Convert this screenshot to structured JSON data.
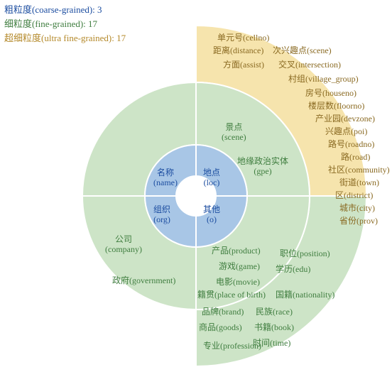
{
  "legend": {
    "coarse": "粗粒度(coarse-grained): 3",
    "fine": "细粒度(fine-grained): 17",
    "ultra": "超细粒度(ultra fine-grained): 17"
  },
  "inner": {
    "name": {
      "zh": "名称",
      "en": "(name)"
    },
    "loc": {
      "zh": "地点",
      "en": "(loc)"
    },
    "org": {
      "zh": "组织",
      "en": "(org)"
    },
    "o": {
      "zh": "其他",
      "en": "(o)"
    }
  },
  "middle": {
    "scene": {
      "zh": "景点",
      "en": "(scene)"
    },
    "gpe": {
      "zh": "地缘政治实体",
      "en": "(gpe)"
    },
    "company": {
      "zh": "公司",
      "en": "(company)"
    },
    "gov": {
      "zh": "政府(government)"
    }
  },
  "outer_top": {
    "cellno": "单元号(cellno)",
    "distance": "距离(distance)",
    "scene2": "次兴趣点(scene)",
    "assist": "方面(assist)",
    "intersection": "交叉(intersection)",
    "village_group": "村组(village_group)",
    "houseno": "房号(houseno)",
    "floorno": "楼层数(floorno)",
    "devzone": "产业园(devzone)",
    "poi": "兴趣点(poi)",
    "roadno": "路号(roadno)",
    "road": "路(road)",
    "community": "社区(community)",
    "town": "街道(town)",
    "district": "区(district)",
    "city": "城市(city)",
    "prov": "省份(prov)"
  },
  "outer_bottom": {
    "product": "产品(product)",
    "position": "职位(position)",
    "game": "游戏(game)",
    "edu": "学历(edu)",
    "movie": "电影(movie)",
    "birthplace": "籍贯(place of birth)",
    "nationality": "国籍(nationality)",
    "brand": "品牌(brand)",
    "race": "民族(race)",
    "goods": "商品(goods)",
    "book": "书籍(book)",
    "time": "时间(time)",
    "profession": "专业(profession)"
  },
  "chart_data": {
    "type": "pie",
    "title": "",
    "rings": [
      {
        "level": "coarse",
        "count": 3,
        "slices": [
          "名称(name)",
          "地点(loc)",
          "组织(org)",
          "其他(o)"
        ]
      },
      {
        "level": "fine",
        "count": 17,
        "slices": [
          "景点(scene)",
          "地缘政治实体(gpe)",
          "公司(company)",
          "政府(government)"
        ]
      },
      {
        "level": "ultra",
        "count": 17,
        "slices": [
          "单元号(cellno)",
          "距离(distance)",
          "次兴趣点(scene)",
          "方面(assist)",
          "交叉(intersection)",
          "村组(village_group)",
          "房号(houseno)",
          "楼层数(floorno)",
          "产业园(devzone)",
          "兴趣点(poi)",
          "路号(roadno)",
          "路(road)",
          "社区(community)",
          "街道(town)",
          "区(district)",
          "城市(city)",
          "省份(prov)",
          "产品(product)",
          "职位(position)",
          "游戏(game)",
          "学历(edu)",
          "电影(movie)",
          "籍贯(place of birth)",
          "国籍(nationality)",
          "品牌(brand)",
          "民族(race)",
          "商品(goods)",
          "书籍(book)",
          "时间(time)",
          "专业(profession)"
        ]
      }
    ]
  }
}
